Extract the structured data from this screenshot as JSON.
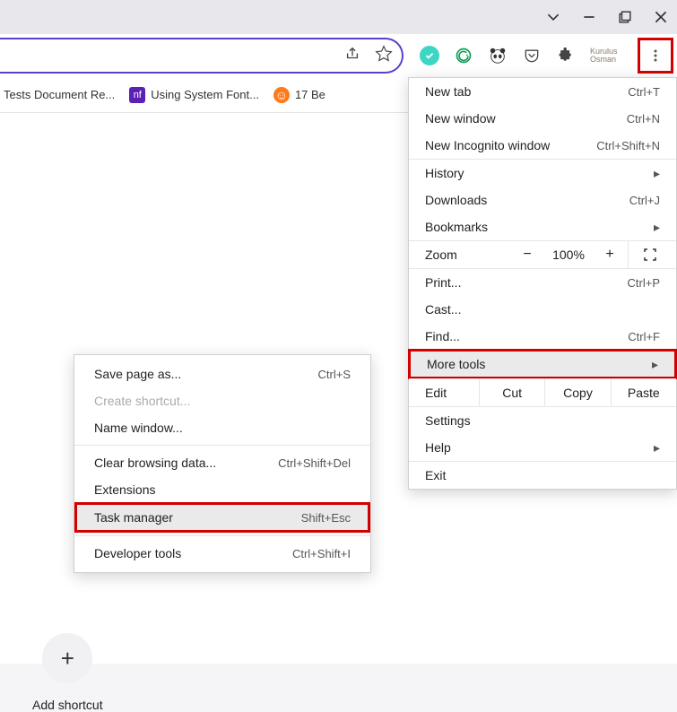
{
  "bookmarks": [
    {
      "label": "Tests Document Re..."
    },
    {
      "label": "Using System Font..."
    },
    {
      "label": "17 Be"
    }
  ],
  "addShortcut": {
    "label": "Add shortcut"
  },
  "menu": {
    "newTab": {
      "label": "New tab",
      "shortcut": "Ctrl+T"
    },
    "newWindow": {
      "label": "New window",
      "shortcut": "Ctrl+N"
    },
    "newIncognito": {
      "label": "New Incognito window",
      "shortcut": "Ctrl+Shift+N"
    },
    "history": {
      "label": "History"
    },
    "downloads": {
      "label": "Downloads",
      "shortcut": "Ctrl+J"
    },
    "bookmarks": {
      "label": "Bookmarks"
    },
    "zoom": {
      "label": "Zoom",
      "minus": "−",
      "value": "100%",
      "plus": "+"
    },
    "print": {
      "label": "Print...",
      "shortcut": "Ctrl+P"
    },
    "cast": {
      "label": "Cast..."
    },
    "find": {
      "label": "Find...",
      "shortcut": "Ctrl+F"
    },
    "moreTools": {
      "label": "More tools"
    },
    "edit": {
      "label": "Edit",
      "cut": "Cut",
      "copy": "Copy",
      "paste": "Paste"
    },
    "settings": {
      "label": "Settings"
    },
    "help": {
      "label": "Help"
    },
    "exit": {
      "label": "Exit"
    }
  },
  "submenu": {
    "savePage": {
      "label": "Save page as...",
      "shortcut": "Ctrl+S"
    },
    "createShortcut": {
      "label": "Create shortcut..."
    },
    "nameWindow": {
      "label": "Name window..."
    },
    "clearBrowsing": {
      "label": "Clear browsing data...",
      "shortcut": "Ctrl+Shift+Del"
    },
    "extensions": {
      "label": "Extensions"
    },
    "taskManager": {
      "label": "Task manager",
      "shortcut": "Shift+Esc"
    },
    "devTools": {
      "label": "Developer tools",
      "shortcut": "Ctrl+Shift+I"
    }
  }
}
